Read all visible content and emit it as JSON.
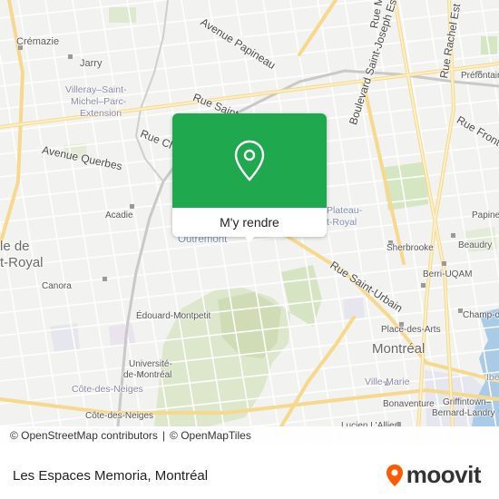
{
  "map": {
    "labels": {
      "cremazie": "Crémazie",
      "jarry": "Jarry",
      "villeray_1": "Villeray–Saint-",
      "villeray_2": "Michel–Parc-",
      "villeray_3": "Extension",
      "avenue_querbes": "Avenue Querbes",
      "avenue_papineau": "Avenue Papineau",
      "rue_saint": "Rue Saint",
      "rue_st_papineau": "Rue St",
      "rue_ch": "Rue Ch",
      "boulevard_st_joseph": "Boulevard Saint-Joseph Est",
      "rue_marie": "Rue Ma",
      "rue_rachel": "Rue Rachel Est",
      "rue_front": "Rue Fronte",
      "prefontaine": "Préfontaine",
      "acadie": "Acadie",
      "outremont": "Outremont",
      "plateau_1": "Plateau-",
      "plateau_2": "t-Royal",
      "mont_royal_1": "le de",
      "mont_royal_2": "t-Royal",
      "rue_saint_urbain": "Rue Saint-Urbain",
      "sherbrooke": "Sherbrooke",
      "beaudry": "Beaudry",
      "berri_uqam": "Berri-UQAM",
      "papineau": "Papine",
      "canora": "Canora",
      "edouard_montpetit": "Édouard-Montpetit",
      "place_des_arts": "Place-des-Arts",
      "champ_de_mars": "Champ-de-Mars",
      "montreal": "Montréal",
      "universite_1": "Université-",
      "universite_2": "de-Montréal",
      "cote_des_neiges_area": "Côte-des-Neiges",
      "cote_des_neiges": "Côte-des-Neiges",
      "ville_marie": "Ville-Marie",
      "bonaventure": "Bonaventure",
      "griffintown_1": "Griffintown–",
      "griffintown_2": "Bernard-Landry",
      "lucien_lallier": "Lucien L'Allier",
      "ibe": "Ibe"
    }
  },
  "popup": {
    "button_label": "M'y rendre",
    "icon": "location-pin-icon",
    "color": "#20a84e"
  },
  "attribution": {
    "osm": "© OpenStreetMap contributors",
    "separator": "|",
    "omt": "© OpenMapTiles"
  },
  "footer": {
    "title": "Les Espaces Memoria, Montréal"
  },
  "brand": {
    "name": "moovit",
    "color": "#ff5a00"
  }
}
